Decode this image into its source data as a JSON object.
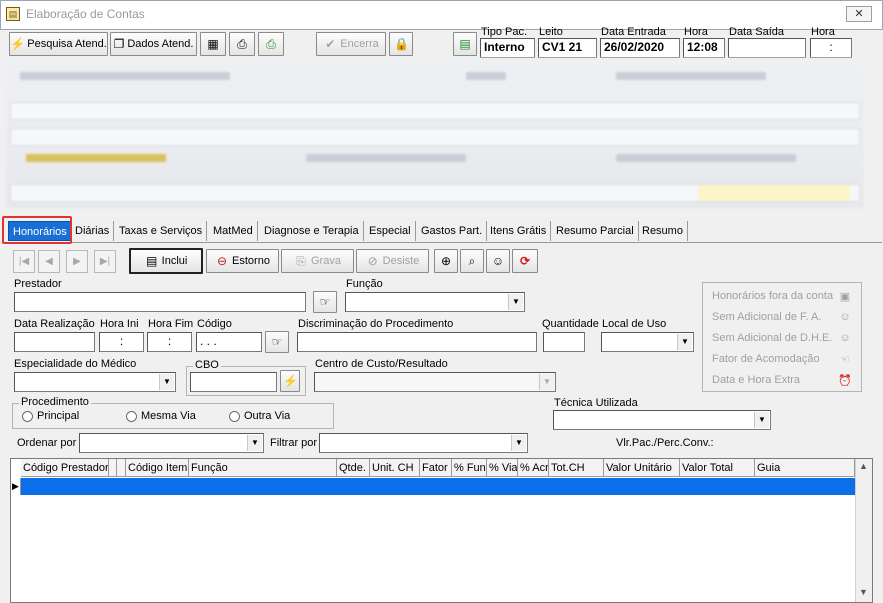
{
  "window": {
    "title": "Elaboração de Contas",
    "close_label": "✕"
  },
  "toolbar": {
    "pesquisa_atend": "Pesquisa Atend.",
    "dados_atend": "Dados Atend.",
    "encerra": "Encerra"
  },
  "atendimento": {
    "tipo_pac_label": "Tipo Pac.",
    "tipo_pac_value": "Interno",
    "leito_label": "Leito",
    "leito_value": "CV1 21",
    "data_entrada_label": "Data Entrada",
    "data_entrada_value": "26/02/2020",
    "hora_label": "Hora",
    "hora_value": "12:08",
    "data_saida_label": "Data Saída",
    "data_saida_value": "",
    "hora_saida_label": "Hora",
    "hora_saida_value": ":"
  },
  "tabs": [
    {
      "label": "Honorários",
      "active": true
    },
    {
      "label": "Diárias"
    },
    {
      "label": "Taxas e Serviços"
    },
    {
      "label": "MatMed"
    },
    {
      "label": "Diagnose e Terapia"
    },
    {
      "label": "Especial"
    },
    {
      "label": "Gastos Part."
    },
    {
      "label": "Itens Grátis"
    },
    {
      "label": "Resumo Parcial"
    },
    {
      "label": "Resumo"
    }
  ],
  "actions": {
    "inclui": "Inclui",
    "estorno": "Estorno",
    "grava": "Grava",
    "desiste": "Desiste"
  },
  "form": {
    "prestador_label": "Prestador",
    "funcao_label": "Função",
    "data_realizacao_label": "Data Realização",
    "hora_ini_label": "Hora Ini",
    "hora_ini_value": ":",
    "hora_fim_label": "Hora Fim",
    "hora_fim_value": ":",
    "codigo_label": "Código",
    "codigo_value": ". . .",
    "discriminacao_label": "Discriminação do Procedimento",
    "quantidade_label": "Quantidade",
    "local_uso_label": "Local de Uso",
    "especialidade_label": "Especialidade do Médico",
    "cbo_label": "CBO",
    "centro_custo_label": "Centro de Custo/Resultado",
    "procedimento_label": "Procedimento",
    "radio_principal": "Principal",
    "radio_mesma_via": "Mesma Via",
    "radio_outra_via": "Outra Via",
    "tecnica_label": "Técnica Utilizada",
    "ordenar_label": "Ordenar por",
    "filtrar_label": "Filtrar por",
    "vlr_label": "Vlr.Pac./Perc.Conv.:"
  },
  "side_options": [
    "Honorários fora da conta",
    "Sem Adicional de F. A.",
    "Sem Adicional de D.H.E.",
    "Fator de Acomodação",
    "Data e Hora Extra"
  ],
  "grid": {
    "columns": [
      "Código Prestador",
      "",
      "",
      "Código Item",
      "Função",
      "Qtde.",
      "Unit. CH",
      "Fator",
      "% Fun",
      "% Via",
      "% Acr",
      "Tot.CH",
      "Valor Unitário",
      "Valor Total",
      "Guia"
    ]
  },
  "colors": {
    "accent": "#1a6fd6",
    "selection": "#0a6fe8",
    "highlight": "#e0342d"
  }
}
